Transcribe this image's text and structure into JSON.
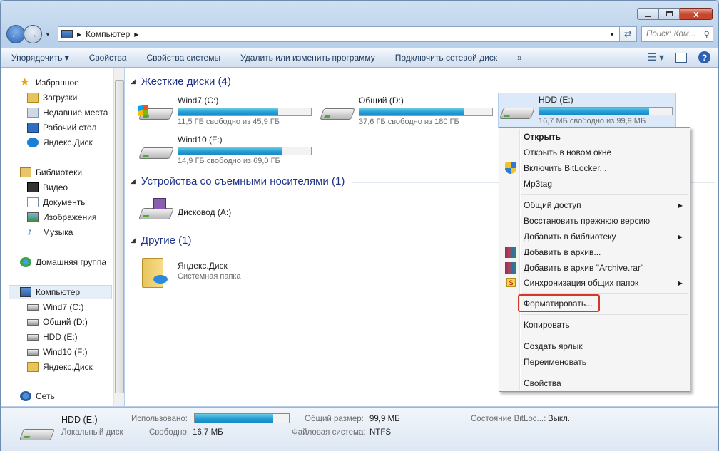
{
  "window": {
    "close": "x"
  },
  "address": {
    "crumb": "Компьютер",
    "search_placeholder": "Поиск: Ком..."
  },
  "toolbar": {
    "items": [
      "Упорядочить ▾",
      "Свойства",
      "Свойства системы",
      "Удалить или изменить программу",
      "Подключить сетевой диск",
      "»"
    ]
  },
  "sidebar": {
    "items": [
      {
        "label": "Избранное",
        "icon": "star-icon"
      },
      {
        "label": "Загрузки",
        "icon": "downloads-icon"
      },
      {
        "label": "Недавние места",
        "icon": "recent-icon"
      },
      {
        "label": "Рабочий стол",
        "icon": "desktop-icon"
      },
      {
        "label": "Яндекс.Диск",
        "icon": "yandex-disk-icon"
      },
      {
        "label": "Библиотеки",
        "icon": "libraries-icon"
      },
      {
        "label": "Видео",
        "icon": "video-icon"
      },
      {
        "label": "Документы",
        "icon": "documents-icon"
      },
      {
        "label": "Изображения",
        "icon": "pictures-icon"
      },
      {
        "label": "Музыка",
        "icon": "music-icon"
      },
      {
        "label": "Домашняя группа",
        "icon": "homegroup-icon"
      },
      {
        "label": "Компьютер",
        "icon": "computer-icon"
      },
      {
        "label": "Wind7 (C:)",
        "icon": "drive-icon"
      },
      {
        "label": "Общий (D:)",
        "icon": "drive-icon"
      },
      {
        "label": "HDD (E:)",
        "icon": "drive-icon"
      },
      {
        "label": "Wind10 (F:)",
        "icon": "drive-icon"
      },
      {
        "label": "Яндекс.Диск",
        "icon": "yandex-disk-icon"
      },
      {
        "label": "Сеть",
        "icon": "network-icon"
      }
    ]
  },
  "groups": {
    "hdd": "Жесткие диски (4)",
    "removable": "Устройства со съемными носителями (1)",
    "other": "Другие (1)"
  },
  "drives": [
    {
      "name": "Wind7 (C:)",
      "free": "11,5 ГБ свободно из 45,9 ГБ",
      "used_fraction": 0.75
    },
    {
      "name": "Общий (D:)",
      "free": "37,6 ГБ свободно из 180 ГБ",
      "used_fraction": 0.79
    },
    {
      "name": "HDD (E:)",
      "free": "16,7 МБ свободно из 99,9 МБ",
      "used_fraction": 0.83
    },
    {
      "name": "Wind10 (F:)",
      "free": "14,9 ГБ свободно из 69,0 ГБ",
      "used_fraction": 0.78
    }
  ],
  "removable": {
    "name": "Дисковод (A:)"
  },
  "other": {
    "name": "Яндекс.Диск",
    "sub": "Системная папка"
  },
  "context_menu": {
    "items": [
      "Открыть",
      "Открыть в новом окне",
      "Включить BitLocker...",
      "Mp3tag",
      "Общий доступ",
      "Восстановить прежнюю версию",
      "Добавить в библиотеку",
      "Добавить в архив...",
      "Добавить в архив \"Archive.rar\"",
      "Синхронизация общих папок",
      "Форматировать...",
      "Копировать",
      "Создать ярлык",
      "Переименовать",
      "Свойства"
    ]
  },
  "status": {
    "name": "HDD (E:)",
    "type": "Локальный диск",
    "used_label": "Использовано:",
    "used_fraction": 0.83,
    "free_label": "Свободно:",
    "free": "16,7 МБ",
    "total_label": "Общий размер:",
    "total": "99,9 МБ",
    "fs_label": "Файловая система:",
    "fs": "NTFS",
    "bitlocker_label": "Состояние BitLoc...:",
    "bitlocker": "Выкл."
  }
}
